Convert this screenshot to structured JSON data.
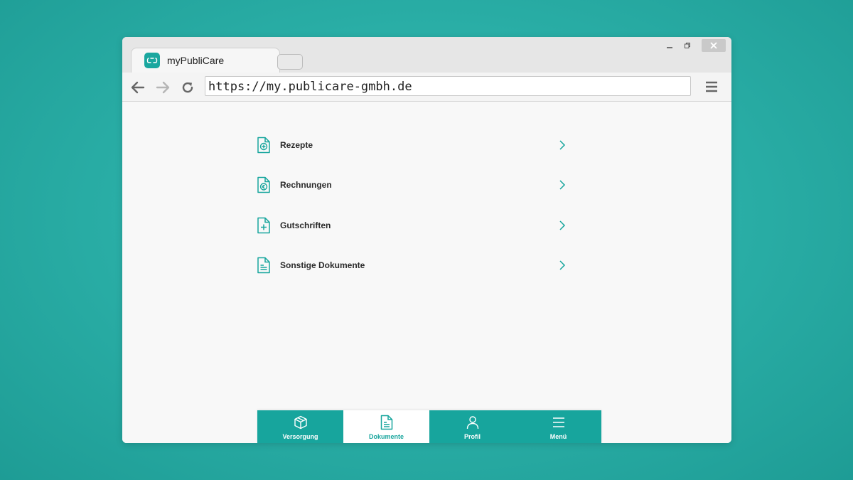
{
  "colors": {
    "accent": "#17a59d",
    "background": "#2bb0a8"
  },
  "browser": {
    "tab_title": "myPubliCare",
    "url": "https://my.publicare-gmbh.de",
    "icons": [
      "back-arrow-icon",
      "forward-arrow-icon",
      "reload-icon",
      "hamburger-menu-icon",
      "minimize-icon",
      "maximize-icon",
      "close-icon"
    ]
  },
  "documents": {
    "items": [
      {
        "label": "Rezepte",
        "icon": "prescription-document-icon"
      },
      {
        "label": "Rechnungen",
        "icon": "invoice-euro-document-icon"
      },
      {
        "label": "Gutschriften",
        "icon": "credit-plus-document-icon"
      },
      {
        "label": "Sonstige Dokumente",
        "icon": "text-document-icon"
      }
    ]
  },
  "bottom_nav": {
    "tabs": [
      {
        "label": "Versorgung",
        "icon": "box-icon",
        "active": false
      },
      {
        "label": "Dokumente",
        "icon": "document-icon",
        "active": true
      },
      {
        "label": "Profil",
        "icon": "person-icon",
        "active": false
      },
      {
        "label": "Menü",
        "icon": "menu-icon",
        "active": false
      }
    ]
  }
}
